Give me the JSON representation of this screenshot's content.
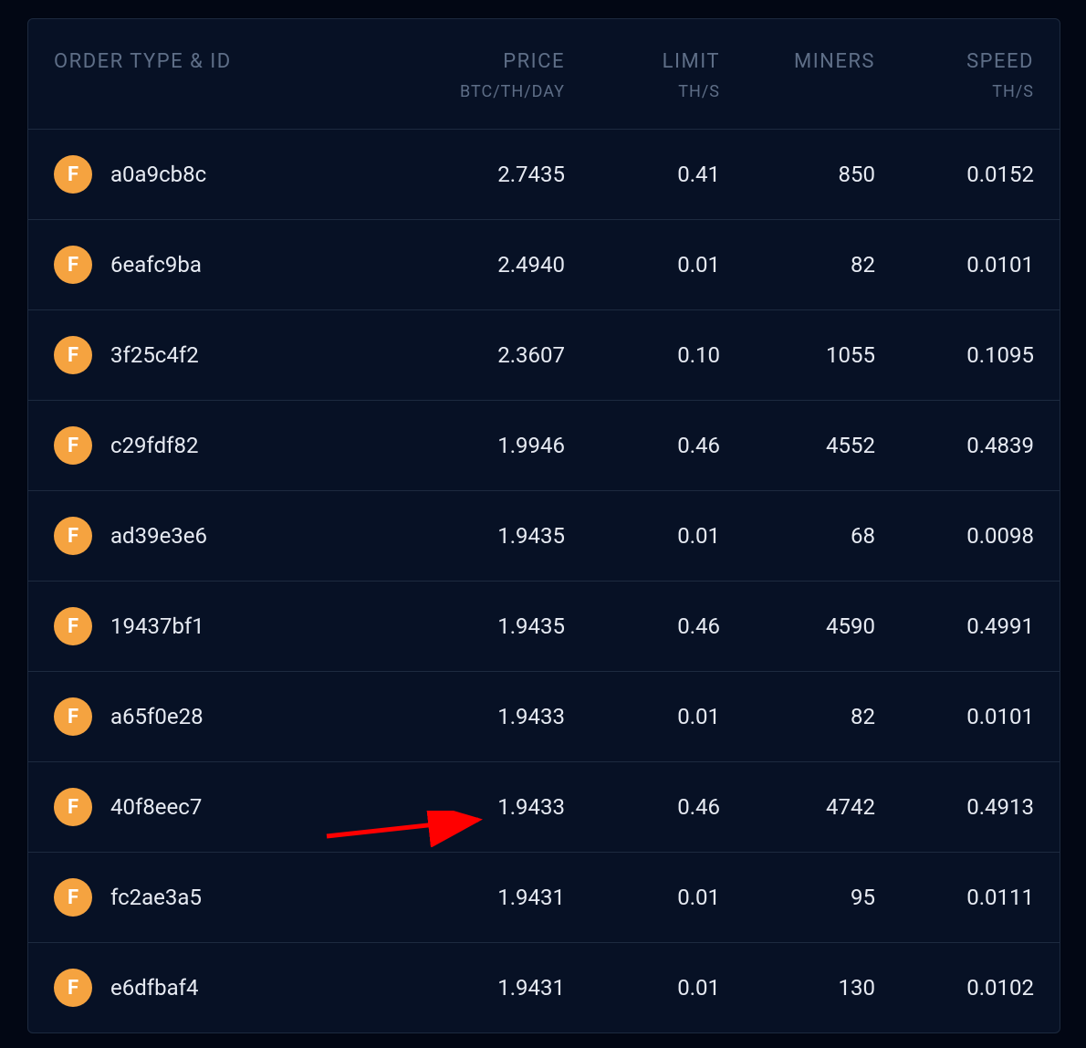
{
  "colors": {
    "bg": "#020714",
    "panel": "#071125",
    "border": "#1d2a3f",
    "muted": "#5e6e87",
    "text": "#e6eaf2",
    "badge": "#f5a340",
    "arrow": "#ff0000"
  },
  "header": {
    "order": "ORDER TYPE & ID",
    "price": "PRICE",
    "price_sub": "BTC/TH/DAY",
    "limit": "LIMIT",
    "limit_sub": "TH/S",
    "miners": "MINERS",
    "speed": "SPEED",
    "speed_sub": "TH/S"
  },
  "badge_letter": "F",
  "rows": [
    {
      "id": "a0a9cb8c",
      "price": "2.7435",
      "limit": "0.41",
      "miners": "850",
      "speed": "0.0152"
    },
    {
      "id": "6eafc9ba",
      "price": "2.4940",
      "limit": "0.01",
      "miners": "82",
      "speed": "0.0101"
    },
    {
      "id": "3f25c4f2",
      "price": "2.3607",
      "limit": "0.10",
      "miners": "1055",
      "speed": "0.1095"
    },
    {
      "id": "c29fdf82",
      "price": "1.9946",
      "limit": "0.46",
      "miners": "4552",
      "speed": "0.4839"
    },
    {
      "id": "ad39e3e6",
      "price": "1.9435",
      "limit": "0.01",
      "miners": "68",
      "speed": "0.0098"
    },
    {
      "id": "19437bf1",
      "price": "1.9435",
      "limit": "0.46",
      "miners": "4590",
      "speed": "0.4991"
    },
    {
      "id": "a65f0e28",
      "price": "1.9433",
      "limit": "0.01",
      "miners": "82",
      "speed": "0.0101"
    },
    {
      "id": "40f8eec7",
      "price": "1.9433",
      "limit": "0.46",
      "miners": "4742",
      "speed": "0.4913"
    },
    {
      "id": "fc2ae3a5",
      "price": "1.9431",
      "limit": "0.01",
      "miners": "95",
      "speed": "0.0111"
    },
    {
      "id": "e6dfbaf4",
      "price": "1.9431",
      "limit": "0.01",
      "miners": "130",
      "speed": "0.0102"
    }
  ],
  "annotation": {
    "highlighted_row_index": 7
  }
}
